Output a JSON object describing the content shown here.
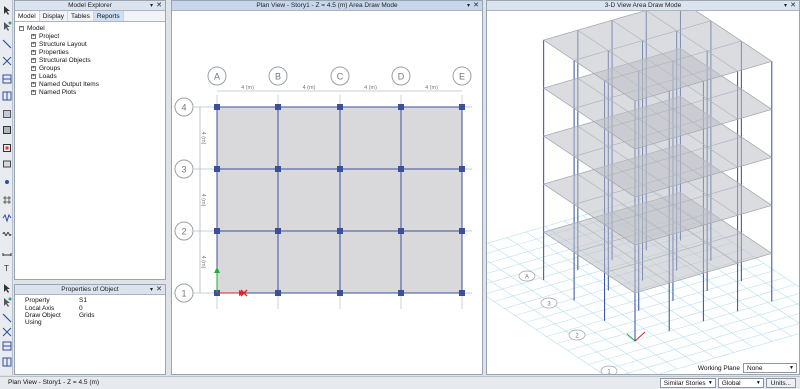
{
  "model_explorer": {
    "title": "Model Explorer",
    "tabs": [
      "Model",
      "Display",
      "Tables",
      "Reports"
    ],
    "tree_root": "Model",
    "tree_items": [
      "Project",
      "Structure Layout",
      "Properties",
      "Structural Objects",
      "Groups",
      "Loads",
      "Named Output Items",
      "Named Plots"
    ]
  },
  "properties": {
    "title": "Properties of Object",
    "rows": [
      {
        "key": "Property",
        "value": "S1"
      },
      {
        "key": "Local Axis",
        "value": "0"
      },
      {
        "key": "Draw Object Using",
        "value": "Grids"
      }
    ]
  },
  "plan_view": {
    "title": "Plan View - Story1 - Z = 4.5 (m)  Area Draw Mode",
    "grid_x_labels": [
      "A",
      "B",
      "C",
      "D",
      "E"
    ],
    "grid_y_labels": [
      "4",
      "3",
      "2",
      "1"
    ],
    "spacing_label": "4 (m)"
  },
  "view_3d": {
    "title": "3-D View  Area Draw Mode",
    "grid_bubbles": [
      "A",
      "3",
      "2",
      "1"
    ],
    "working_plane_label": "Working Plane",
    "working_plane_value": "None"
  },
  "status_bar": {
    "text": "Plan View - Story1 - Z = 4.5 (m)",
    "stories_value": "Similar Stories",
    "coord_system_value": "Global",
    "units_label": "Units..."
  },
  "icons": [
    "pointer-icon",
    "reshape-icon",
    "draw-frame-icon",
    "draw-brace-icon",
    "draw-beam-icon",
    "draw-column-icon",
    "draw-area-icon",
    "draw-wall-icon",
    "draw-opening-icon",
    "draw-slab-icon",
    "draw-point-icon",
    "draw-grid-icon",
    "draw-link-icon",
    "draw-spring-icon",
    "draw-dimension-icon",
    "draw-text-icon"
  ],
  "colors": {
    "accent": "#2f4ea0",
    "slab": "#d9d9dc",
    "node": "#3c4f9a",
    "axis_x": "#e0202a",
    "axis_y": "#19b23a"
  }
}
